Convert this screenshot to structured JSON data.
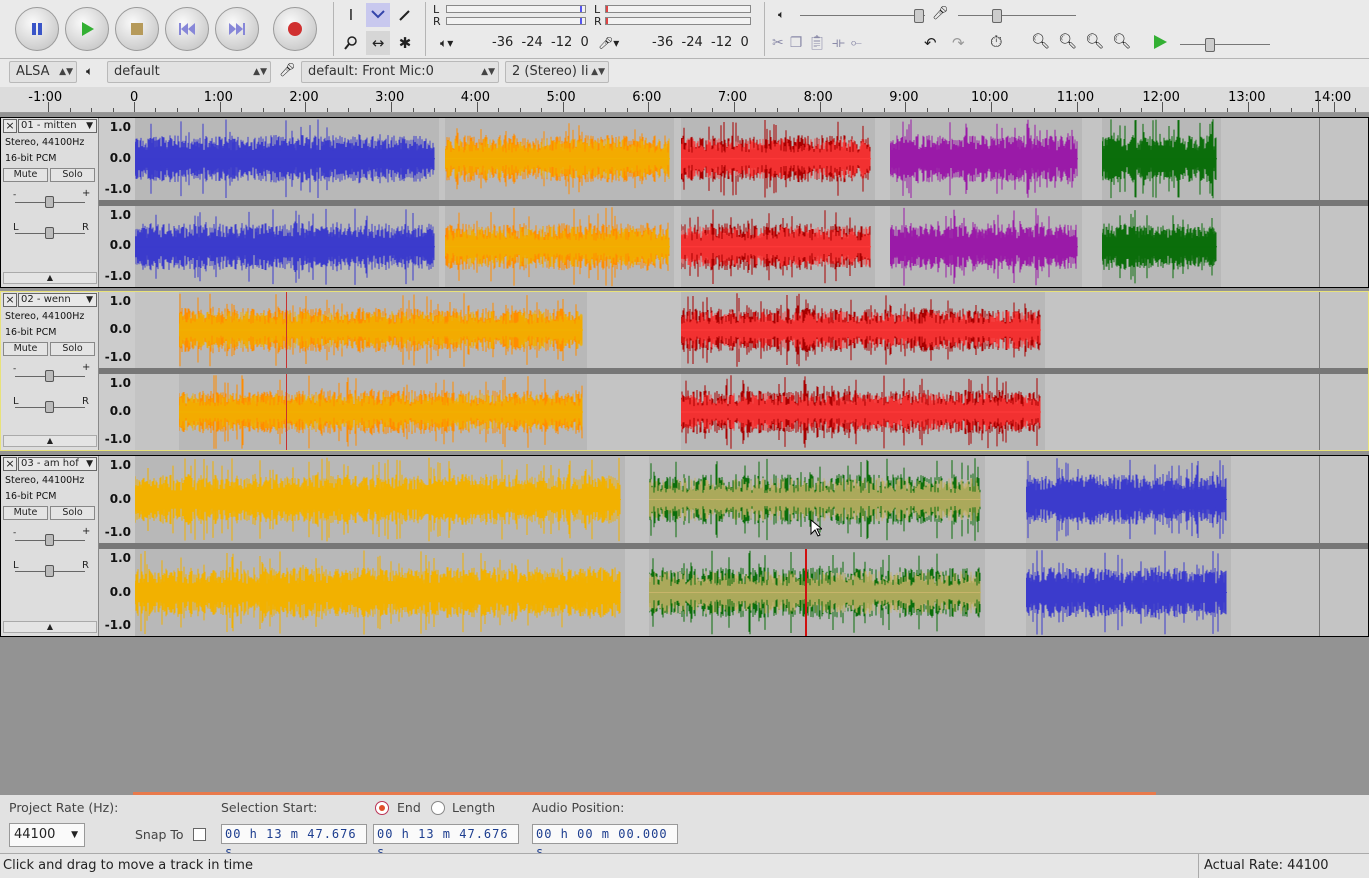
{
  "transport": {
    "pause": "pause-button",
    "play": "play-button",
    "stop": "stop-button",
    "skip_start": "skip-to-start-button",
    "skip_end": "skip-to-end-button",
    "record": "record-button"
  },
  "meters": {
    "left": "L",
    "right": "R",
    "scale_play": [
      "-36",
      "-24",
      "-12",
      "0"
    ],
    "scale_rec": [
      "-36",
      "-24",
      "-12",
      "0"
    ]
  },
  "device": {
    "host": "ALSA",
    "output": "default",
    "input": "default: Front Mic:0",
    "channels": "2 (Stereo) Ii"
  },
  "ruler": {
    "labels": [
      "-1:00",
      "0",
      "1:00",
      "2:00",
      "3:00",
      "4:00",
      "5:00",
      "6:00",
      "7:00",
      "8:00",
      "9:00",
      "10:00",
      "11:00",
      "12:00",
      "13:00",
      "14:00"
    ]
  },
  "tracks": [
    {
      "name": "01 - mitten",
      "info1": "Stereo, 44100Hz",
      "info2": "16-bit PCM",
      "mute": "Mute",
      "solo": "Solo",
      "gain_l": "-",
      "gain_r": "+",
      "pan_l": "L",
      "pan_r": "R",
      "scale": [
        "1.0",
        "0.0",
        "-1.0"
      ]
    },
    {
      "name": "02 - wenn",
      "info1": "Stereo, 44100Hz",
      "info2": "16-bit PCM",
      "mute": "Mute",
      "solo": "Solo",
      "gain_l": "-",
      "gain_r": "+",
      "pan_l": "L",
      "pan_r": "R",
      "scale": [
        "1.0",
        "0.0",
        "-1.0"
      ]
    },
    {
      "name": "03 - am hof",
      "info1": "Stereo, 44100Hz",
      "info2": "16-bit PCM",
      "mute": "Mute",
      "solo": "Solo",
      "gain_l": "-",
      "gain_r": "+",
      "pan_l": "L",
      "pan_r": "R",
      "scale": [
        "1.0",
        "0.0",
        "-1.0"
      ]
    }
  ],
  "colors": {
    "blue": "#3b3bcc",
    "orange": "#ff8c00",
    "darkred": "#a80000",
    "red": "#ff3a3a",
    "purple": "#9a1aa8",
    "green": "#0b6e0b",
    "yellow": "#f2b100",
    "khaki": "#c8b46a"
  },
  "bottom": {
    "rate_label": "Project Rate (Hz):",
    "rate_value": "44100",
    "snap_label": "Snap To",
    "sel_label": "Selection Start:",
    "end_label": "End",
    "length_label": "Length",
    "pos_label": "Audio Position:",
    "sel_start": "00 h 13 m 47.676 s",
    "sel_end": "00 h 13 m 47.676 s",
    "position": "00 h 00 m 00.000 s"
  },
  "status": {
    "message": "Click and drag to move a track in time",
    "rate": "Actual Rate: 44100"
  }
}
